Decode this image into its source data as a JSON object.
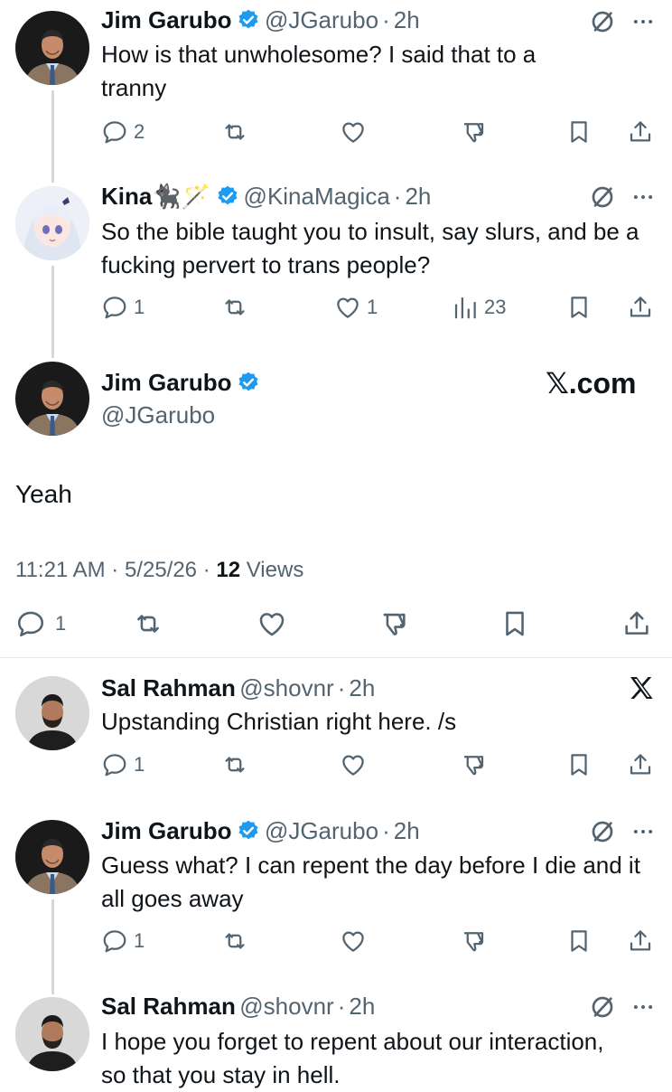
{
  "posts": [
    {
      "name": "Jim Garubo",
      "handle": "@JGarubo",
      "time": "2h",
      "text": "How is that unwholesome? I said that to a tranny",
      "replies": "2",
      "likes": "",
      "views": ""
    },
    {
      "name": "Kina🐈‍⬛🪄",
      "handle": "@KinaMagica",
      "time": "2h",
      "text": "So the bible taught you to insult, say slurs, and be a fucking pervert to trans people?",
      "replies": "1",
      "likes": "1",
      "views": "23"
    }
  ],
  "main_post": {
    "name": "Jim Garubo",
    "handle": "@JGarubo",
    "brand": "𝕏.com",
    "text": "Yeah",
    "timestamp": "11:21 AM · 5/25/26 ·",
    "views_count": "12",
    "views_label": "Views",
    "replies": "1"
  },
  "replies": [
    {
      "name": "Sal Rahman",
      "handle": "@shovnr",
      "time": "2h",
      "text": "Upstanding Christian right here. /s",
      "replies": "1"
    },
    {
      "name": "Jim Garubo",
      "handle": "@JGarubo",
      "time": "2h",
      "text": "Guess what? I can repent the day before I die and it all goes away",
      "replies": "1"
    },
    {
      "name": "Sal Rahman",
      "handle": "@shovnr",
      "time": "2h",
      "text": "I hope you forget to repent about our interaction, so that you stay in hell."
    }
  ],
  "separator": "·",
  "colors": {
    "verified": "#1d9bf0",
    "muted": "#536471",
    "text": "#0f1419",
    "line": "#cfd9de"
  }
}
